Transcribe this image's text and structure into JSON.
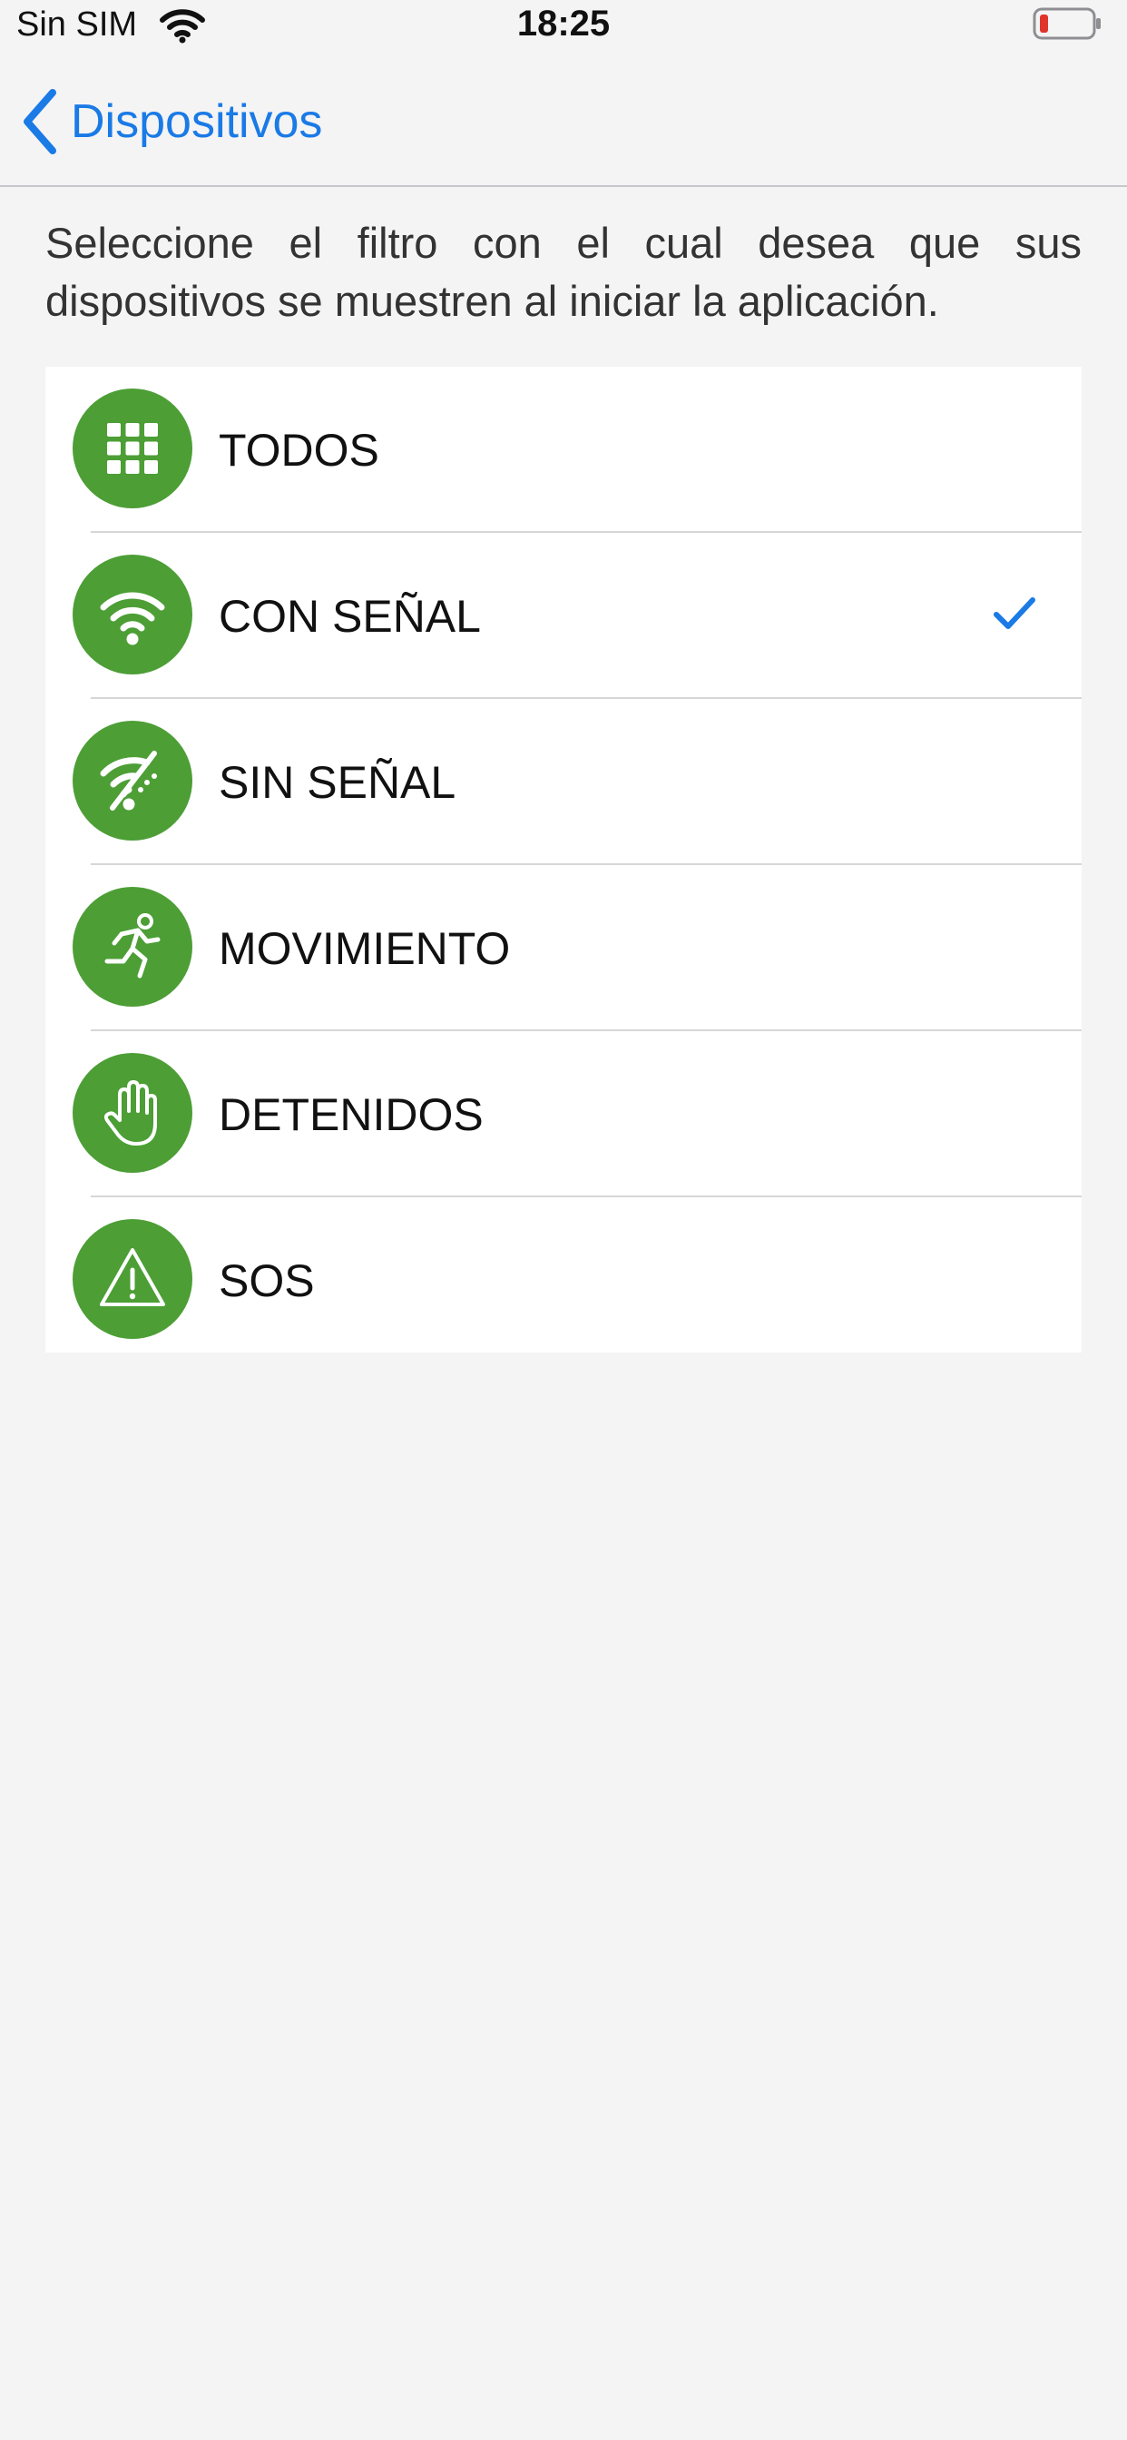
{
  "status_bar": {
    "carrier": "Sin SIM",
    "time": "18:25",
    "battery_color": "#e0342a"
  },
  "nav": {
    "back_label": "Dispositivos",
    "accent_color": "#1a7ae6"
  },
  "description": "Seleccione el filtro con el cual desea que sus dispositivos se muestren al iniciar la aplicación.",
  "icon_color": "#4c9e35",
  "filters": [
    {
      "label": "TODOS",
      "icon": "grid-icon",
      "selected": false
    },
    {
      "label": "CON SEÑAL",
      "icon": "wifi-signal-icon",
      "selected": true
    },
    {
      "label": "SIN SEÑAL",
      "icon": "wifi-off-icon",
      "selected": false
    },
    {
      "label": "MOVIMIENTO",
      "icon": "running-person-icon",
      "selected": false
    },
    {
      "label": "DETENIDOS",
      "icon": "hand-stop-icon",
      "selected": false
    },
    {
      "label": "SOS",
      "icon": "warning-triangle-icon",
      "selected": false
    }
  ]
}
